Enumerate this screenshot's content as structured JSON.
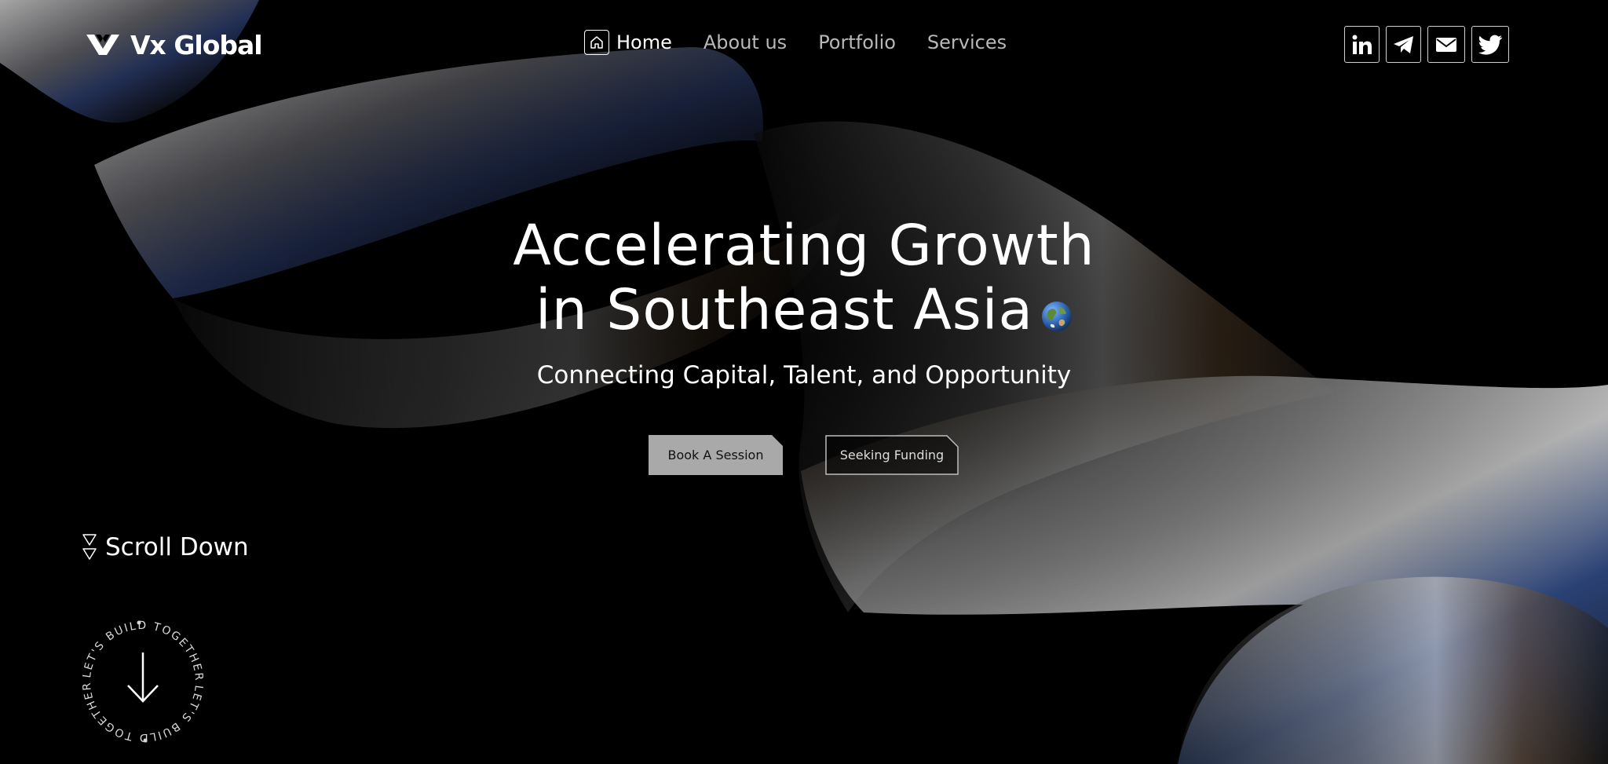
{
  "brand": {
    "name": "Vx Global",
    "accent": "#ffffff",
    "background": "#000000"
  },
  "nav": {
    "items": [
      {
        "label": "Home",
        "icon": "home-icon",
        "active": true
      },
      {
        "label": "About us"
      },
      {
        "label": "Portfolio"
      },
      {
        "label": "Services"
      }
    ]
  },
  "social": [
    {
      "name": "linkedin-icon"
    },
    {
      "name": "telegram-icon"
    },
    {
      "name": "mail-icon"
    },
    {
      "name": "twitter-icon"
    }
  ],
  "hero": {
    "title_line1": "Accelerating Growth",
    "title_line2": "in Southeast Asia",
    "title_icon": "globe-icon",
    "subtitle": "Connecting Capital, Talent, and Opportunity",
    "primary_cta": "Book A Session",
    "secondary_cta": "Seeking Funding"
  },
  "scroll": {
    "label": "Scroll Down",
    "icon": "double-triangle-down-icon"
  },
  "badge": {
    "text_top": "LET'S BUILD TOGETHER",
    "text_bottom": "LET'S BUILD TOGETHER",
    "icon": "arrow-down-icon"
  }
}
